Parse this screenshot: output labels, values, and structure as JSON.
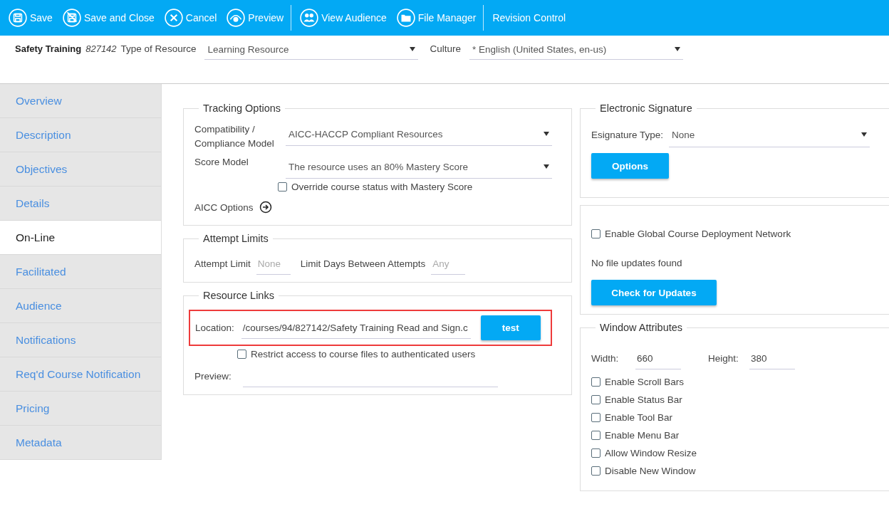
{
  "toolbar": [
    {
      "label": "Save",
      "kind": "save",
      "separator_after": false
    },
    {
      "label": "Save and Close",
      "kind": "save-close",
      "separator_after": false
    },
    {
      "label": "Cancel",
      "kind": "cancel",
      "separator_after": false
    },
    {
      "label": "Preview",
      "kind": "preview",
      "separator_after": true
    },
    {
      "label": "View Audience",
      "kind": "audience",
      "separator_after": false
    },
    {
      "label": "File Manager",
      "kind": "folder",
      "separator_after": true
    },
    {
      "label": "Revision Control",
      "kind": "text",
      "separator_after": false
    }
  ],
  "header": {
    "title": "Safety Training",
    "code": "827142",
    "type_label": "Type of Resource",
    "type_value": "Learning Resource",
    "culture_label": "Culture",
    "culture_value": "* English (United States, en-us)"
  },
  "sidebar": {
    "items": [
      {
        "label": "Overview",
        "selected": false
      },
      {
        "label": "Description",
        "selected": false
      },
      {
        "label": "Objectives",
        "selected": false
      },
      {
        "label": "Details",
        "selected": false
      },
      {
        "label": "On-Line",
        "selected": true
      },
      {
        "label": "Facilitated",
        "selected": false
      },
      {
        "label": "Audience",
        "selected": false
      },
      {
        "label": "Notifications",
        "selected": false
      },
      {
        "label": "Req'd Course Notification",
        "selected": false
      },
      {
        "label": "Pricing",
        "selected": false
      },
      {
        "label": "Metadata",
        "selected": false
      }
    ]
  },
  "tracking_options": {
    "title": "Tracking Options",
    "compat_label": "Compatibility / Compliance Model",
    "compat_value": "AICC-HACCP Compliant Resources",
    "score_label": "Score Model",
    "score_value": "The resource uses an 80% Mastery Score",
    "override": {
      "label": "Override course status with Mastery Score",
      "checked": false
    },
    "aicc_options": "AICC Options"
  },
  "attempt_limits": {
    "title": "Attempt Limits",
    "limit_label": "Attempt Limit",
    "limit_placeholder": "None",
    "days_label": "Limit Days Between Attempts",
    "days_placeholder": "Any"
  },
  "resource_links": {
    "title": "Resource Links",
    "location_label": "Location:",
    "location_value": "/courses/94/827142/Safety Training Read and Sign.c",
    "test_button": "test",
    "highlighted": true,
    "restrict": {
      "label": "Restrict access to course files to authenticated users",
      "checked": false
    },
    "preview_label": "Preview:"
  },
  "electronic_signature": {
    "title": "Electronic Signature",
    "type_label": "Esignature Type:",
    "type_value": "None",
    "options_button": "Options"
  },
  "deployment": {
    "cdn": {
      "label": "Enable Global Course Deployment Network",
      "checked": false
    },
    "status": "No file updates found",
    "check_button": "Check for Updates"
  },
  "window_attributes": {
    "title": "Window Attributes",
    "width_label": "Width:",
    "width_value": "660",
    "height_label": "Height:",
    "height_value": "380",
    "options": [
      {
        "label": "Enable Scroll Bars",
        "checked": false
      },
      {
        "label": "Enable Status Bar",
        "checked": false
      },
      {
        "label": "Enable Tool Bar",
        "checked": false
      },
      {
        "label": "Enable Menu Bar",
        "checked": false
      },
      {
        "label": "Allow Window Resize",
        "checked": false
      },
      {
        "label": "Disable New Window",
        "checked": false
      }
    ]
  }
}
